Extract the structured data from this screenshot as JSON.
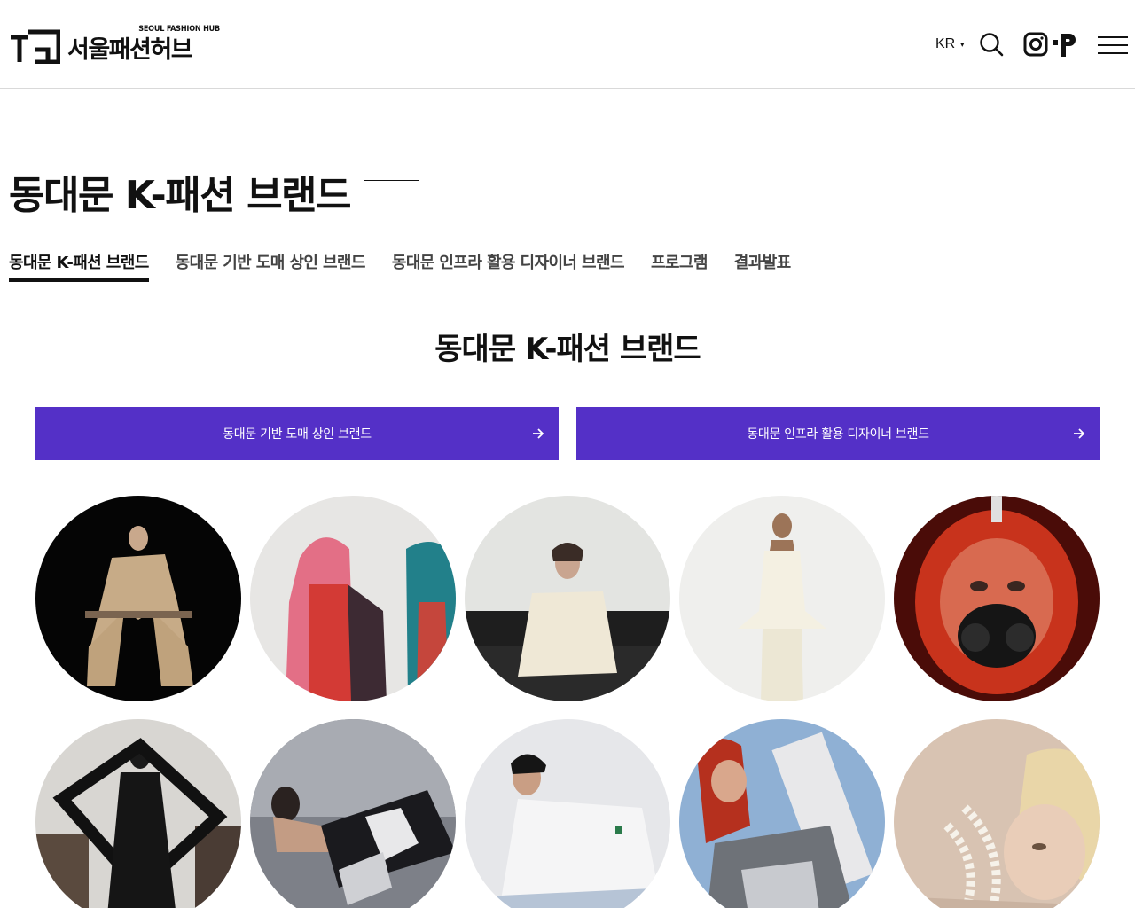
{
  "header": {
    "logo_sub": "SEOUL FASHION HUB",
    "logo_ko": "서울패션허브",
    "lang": "KR",
    "icons": [
      "search-icon",
      "instagram-icon",
      "p-brand-icon",
      "menu-icon"
    ]
  },
  "page": {
    "title": "동대문 K-패션 브랜드"
  },
  "tabs": [
    {
      "label": "동대문 K-패션 브랜드",
      "active": true
    },
    {
      "label": "동대문 기반 도매 상인 브랜드",
      "active": false
    },
    {
      "label": "동대문 인프라 활용 디자이너 브랜드",
      "active": false
    },
    {
      "label": "프로그램",
      "active": false
    },
    {
      "label": "결과발표",
      "active": false
    }
  ],
  "section": {
    "title": "동대문 K-패션 브랜드"
  },
  "ctas": [
    {
      "label": "동대문 기반 도매 상인 브랜드",
      "icon": "arrow-right-icon"
    },
    {
      "label": "동대문 인프라 활용 디자이너 브랜드",
      "icon": "arrow-right-icon"
    }
  ],
  "colors": {
    "accent": "#5430c7",
    "text": "#111111",
    "border": "#d9d9d9"
  }
}
